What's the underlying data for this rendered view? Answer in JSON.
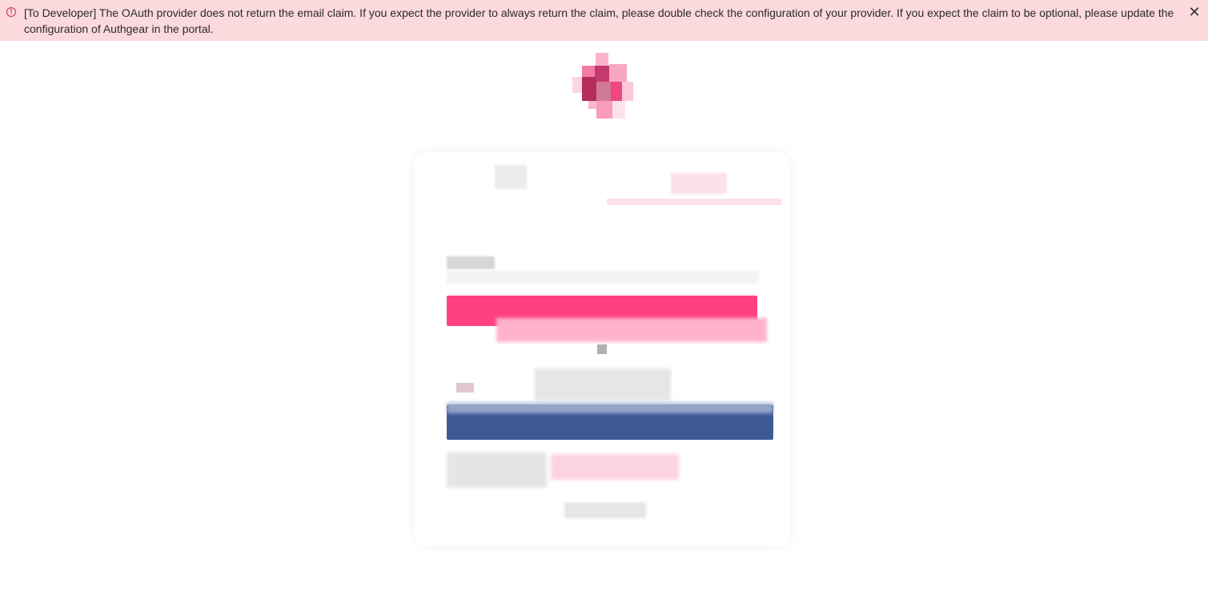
{
  "banner": {
    "message": "[To Developer] The OAuth provider does not return the email claim. If you expect the provider to always return the claim, please double check the configuration of your provider. If you expect the claim to be optional, please update the configuration of Authgear in the portal.",
    "icon": "error-circle-icon",
    "close_icon": "close-icon",
    "close_glyph": "✕",
    "background": "#fbd9dd",
    "icon_color": "#c4314b"
  },
  "colors": {
    "primary_button": "#ff4181",
    "oauth_button": "#3d5a96"
  }
}
